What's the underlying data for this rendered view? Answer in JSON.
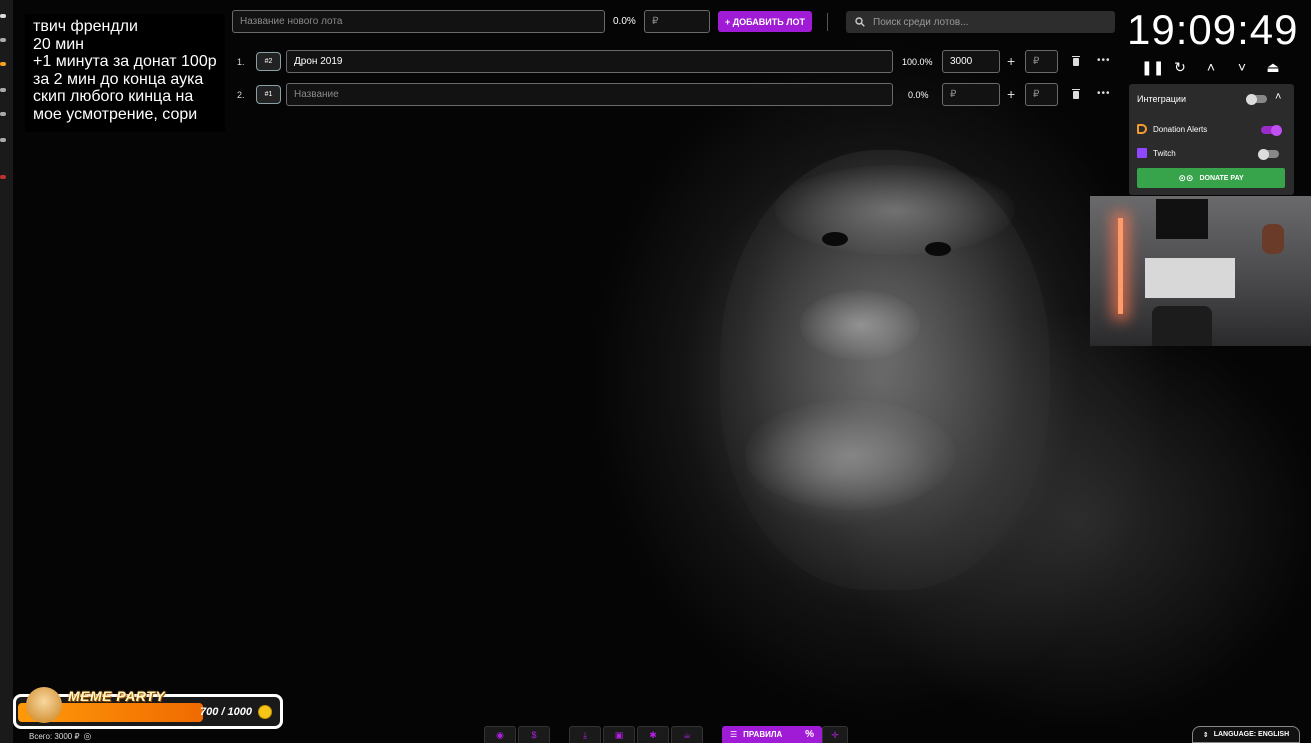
{
  "info_lines": [
    "твич френдли",
    "20 мин",
    "+1 минута за донат 100р",
    "за 2 мин до конца аука",
    "скип любого кинца на",
    "мое усмотрение, сори"
  ],
  "topbar": {
    "new_lot_placeholder": "Название нового лота",
    "new_lot_percent": "0.0%",
    "new_lot_amount_placeholder": "₽",
    "add_lot_label": "+ ДОБАВИТЬ ЛОТ",
    "search_placeholder": "Поиск среди лотов..."
  },
  "lots": [
    {
      "index": "1.",
      "id": "#2",
      "name": "Дрон 2019",
      "name_placeholder": "Название",
      "percent": "100.0%",
      "amount": "3000",
      "add_amount_placeholder": "₽"
    },
    {
      "index": "2.",
      "id": "#1",
      "name": "",
      "name_placeholder": "Название",
      "percent": "0.0%",
      "amount": "",
      "amount_placeholder": "₽",
      "add_amount_placeholder": "₽"
    }
  ],
  "timer": {
    "display": "19:09:49"
  },
  "integrations": {
    "title": "Интеграции",
    "master_enabled": false,
    "items": [
      {
        "label": "Donation Alerts",
        "enabled": true
      },
      {
        "label": "Twitch",
        "enabled": false
      }
    ],
    "donate_pay_label": "DONATE PAY"
  },
  "progress_widget": {
    "title": "MEME PARTY",
    "current": 700,
    "goal": 1000,
    "count_text": "700 / 1000",
    "fraction": 0.7
  },
  "total": {
    "text": "Всего: 3000 ₽"
  },
  "toolbar": {
    "rules_label": "ПРАВИЛА",
    "rules_percent": "%"
  },
  "language": {
    "label": "LANGUAGE: ENGLISH"
  },
  "colors": {
    "accent": "#a01bd6",
    "donate_pay": "#37a34a",
    "progress": "#ff8a0a"
  }
}
